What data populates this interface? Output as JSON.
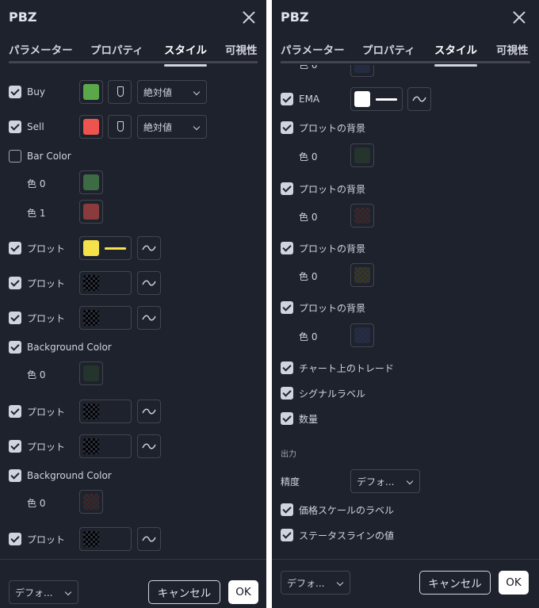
{
  "dialog": {
    "title": "PBZ",
    "tabs": [
      "パラメーター",
      "プロパティ",
      "スタイル",
      "可視性"
    ],
    "active_tab": "スタイル"
  },
  "left": {
    "rows": [
      {
        "type": "checkbox",
        "label": "Buy",
        "checked": true,
        "color": "#5aa84a",
        "value_mode": "絶対値"
      },
      {
        "type": "checkbox",
        "label": "Sell",
        "checked": true,
        "color": "#ef5350",
        "value_mode": "絶対値"
      },
      {
        "type": "checkbox",
        "label": "Bar Color",
        "checked": false
      },
      {
        "type": "sub",
        "label": "色 0",
        "color": "#3d6b43"
      },
      {
        "type": "sub",
        "label": "色 1",
        "color": "#8b3b3b"
      },
      {
        "type": "plot",
        "label": "プロット",
        "checked": true,
        "color": "#f5e14a"
      },
      {
        "type": "plot",
        "label": "プロット",
        "checked": true,
        "color": "transparent"
      },
      {
        "type": "plot",
        "label": "プロット",
        "checked": true,
        "color": "transparent"
      },
      {
        "type": "checkbox",
        "label": "Background Color",
        "checked": true
      },
      {
        "type": "sub",
        "label": "色 0",
        "color": "transparent-green"
      },
      {
        "type": "plot",
        "label": "プロット",
        "checked": true,
        "color": "transparent"
      },
      {
        "type": "plot",
        "label": "プロット",
        "checked": true,
        "color": "transparent"
      },
      {
        "type": "checkbox",
        "label": "Background Color",
        "checked": true
      },
      {
        "type": "sub",
        "label": "色 0",
        "color": "transparent-red"
      },
      {
        "type": "plot",
        "label": "プロット",
        "checked": true,
        "color": "transparent"
      }
    ],
    "footer": {
      "defaults": "デフォ...",
      "cancel": "キャンセル",
      "ok": "OK"
    }
  },
  "right": {
    "partial_top_label": "色 0",
    "ema": {
      "label": "EMA",
      "checked": true,
      "color": "#ffffff"
    },
    "backgrounds": [
      {
        "label": "プロットの背景",
        "checked": true,
        "sub_label": "色 0",
        "tint": "green"
      },
      {
        "label": "プロットの背景",
        "checked": true,
        "sub_label": "色 0",
        "tint": "red"
      },
      {
        "label": "プロットの背景",
        "checked": true,
        "sub_label": "色 0",
        "tint": "olive"
      },
      {
        "label": "プロットの背景",
        "checked": true,
        "sub_label": "色 0",
        "tint": "blue"
      }
    ],
    "checks": [
      {
        "label": "チャート上のトレード",
        "checked": true
      },
      {
        "label": "シグナルラベル",
        "checked": true
      },
      {
        "label": "数量",
        "checked": true
      }
    ],
    "output_section": "出力",
    "precision": {
      "label": "精度",
      "value": "デフォ..."
    },
    "output_checks": [
      {
        "label": "価格スケールのラベル",
        "checked": true
      },
      {
        "label": "ステータスラインの値",
        "checked": true
      }
    ],
    "footer": {
      "defaults": "デフォ...",
      "cancel": "キャンセル",
      "ok": "OK"
    }
  }
}
